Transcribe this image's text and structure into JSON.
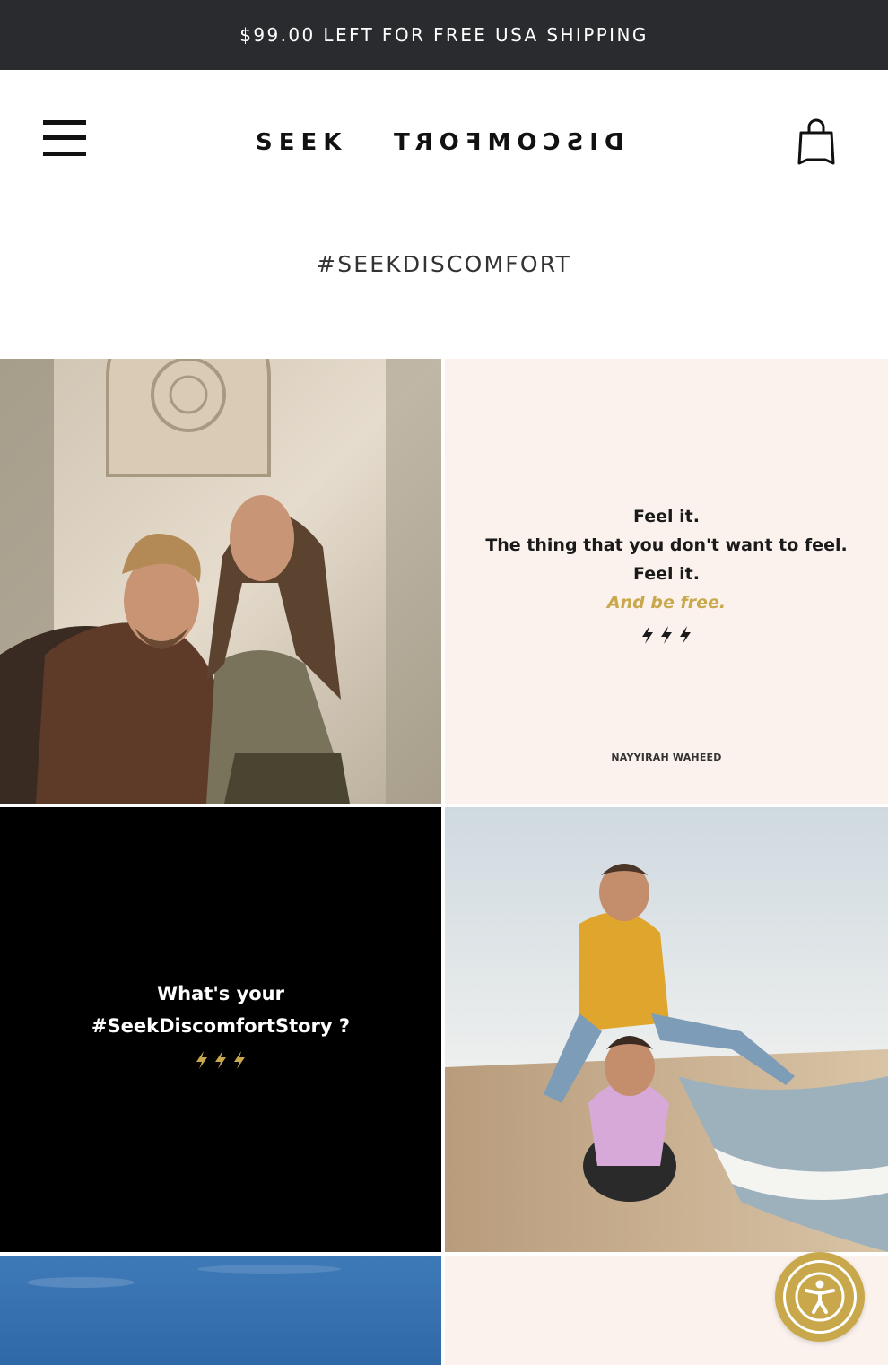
{
  "promo": {
    "text": "$99.00 LEFT FOR FREE USA SHIPPING"
  },
  "header": {
    "logo_left": "SEEK",
    "logo_right": "DISCOMFORT",
    "menu_icon": "hamburger-menu-icon",
    "cart_icon": "shopping-bag-icon"
  },
  "page": {
    "title": "#SEEKDISCOMFORT"
  },
  "gallery": {
    "quote_tile": {
      "lines": [
        "Feel it.",
        "The thing that you don't want to feel.",
        "Feel it."
      ],
      "highlight": "And be free.",
      "author": "NAYYIRAH WAHEED"
    },
    "story_tile": {
      "lines": [
        "What's your",
        "#SeekDiscomfortStory ?"
      ]
    }
  },
  "accessibility": {
    "icon": "accessibility-icon"
  },
  "colors": {
    "promo_bg": "#2a2b2e",
    "accent_gold": "#c9a84c",
    "quote_bg": "#fbf2ee"
  }
}
